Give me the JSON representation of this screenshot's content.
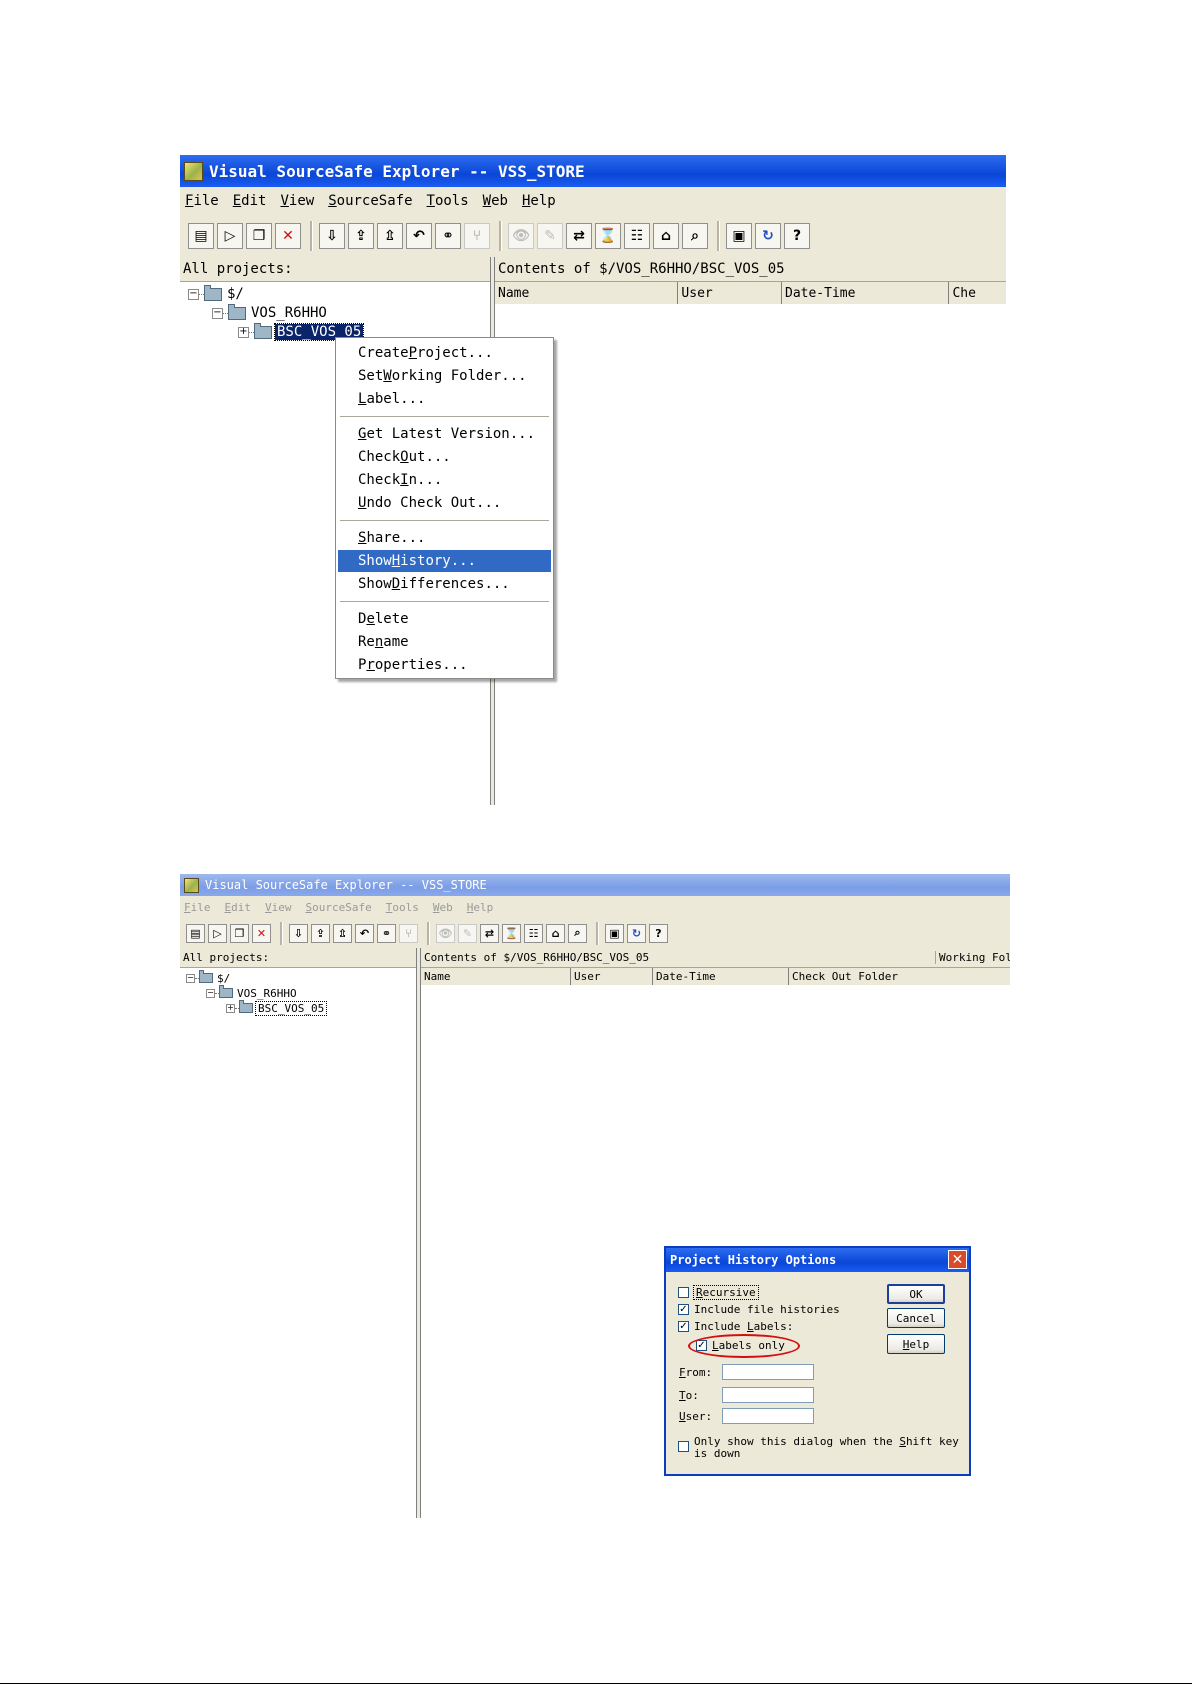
{
  "window_top": {
    "title": "Visual SourceSafe Explorer -- VSS_STORE",
    "menu": [
      {
        "pre": "",
        "u": "F",
        "post": "ile"
      },
      {
        "pre": "",
        "u": "E",
        "post": "dit"
      },
      {
        "pre": "",
        "u": "V",
        "post": "iew"
      },
      {
        "pre": "",
        "u": "S",
        "post": "ourceSafe"
      },
      {
        "pre": "",
        "u": "T",
        "post": "ools"
      },
      {
        "pre": "",
        "u": "W",
        "post": "eb"
      },
      {
        "pre": "",
        "u": "H",
        "post": "elp"
      }
    ],
    "all_projects_label": "All projects:",
    "contents_label": "Contents of $/VOS_R6HHO/BSC_VOS_05",
    "columns": [
      "Name",
      "User",
      "Date-Time",
      "Che"
    ],
    "tree": [
      "$/",
      "VOS_R6HHO",
      "BSC_VOS_05"
    ],
    "context_menu": [
      {
        "pre": "Create ",
        "u": "P",
        "post": "roject..."
      },
      {
        "pre": "Set ",
        "u": "W",
        "post": "orking Folder..."
      },
      {
        "pre": "",
        "u": "L",
        "post": "abel..."
      },
      {
        "pre": "",
        "u": "G",
        "post": "et Latest Version..."
      },
      {
        "pre": "Check ",
        "u": "O",
        "post": "ut..."
      },
      {
        "pre": "Check ",
        "u": "I",
        "post": "n..."
      },
      {
        "pre": "",
        "u": "U",
        "post": "ndo Check Out..."
      },
      {
        "pre": "",
        "u": "S",
        "post": "hare..."
      },
      {
        "pre": "Show ",
        "u": "H",
        "post": "istory..."
      },
      {
        "pre": "Show ",
        "u": "D",
        "post": "ifferences..."
      },
      {
        "pre": "D",
        "u": "e",
        "post": "lete"
      },
      {
        "pre": "Re",
        "u": "n",
        "post": "ame"
      },
      {
        "pre": "P",
        "u": "r",
        "post": "operties..."
      }
    ],
    "highlighted_item": "Show History..."
  },
  "window_bottom": {
    "title": "Visual SourceSafe Explorer -- VSS_STORE",
    "menu": [
      {
        "pre": "",
        "u": "F",
        "post": "ile"
      },
      {
        "pre": "",
        "u": "E",
        "post": "dit"
      },
      {
        "pre": "",
        "u": "V",
        "post": "iew"
      },
      {
        "pre": "",
        "u": "S",
        "post": "ourceSafe"
      },
      {
        "pre": "",
        "u": "T",
        "post": "ools"
      },
      {
        "pre": "",
        "u": "W",
        "post": "eb"
      },
      {
        "pre": "",
        "u": "H",
        "post": "elp"
      }
    ],
    "all_projects_label": "All projects:",
    "contents_label": "Contents of $/VOS_R6HHO/BSC_VOS_05",
    "working_folder_label": "Working Folder",
    "columns": [
      "Name",
      "User",
      "Date-Time",
      "Check Out Folder"
    ],
    "tree": [
      "$/",
      "VOS_R6HHO",
      "BSC_VOS_05"
    ]
  },
  "dialog": {
    "title": "Project History Options",
    "checkboxes": [
      {
        "pre": "",
        "u": "R",
        "post": "ecursive",
        "checked": false
      },
      {
        "pre": "Include file histories",
        "u": "",
        "post": "",
        "checked": true
      },
      {
        "pre": "Include ",
        "u": "L",
        "post": "abels:",
        "checked": true
      },
      {
        "pre": "",
        "u": "L",
        "post": "abels only",
        "checked": true
      }
    ],
    "buttons": [
      {
        "pre": "OK",
        "u": "",
        "post": ""
      },
      {
        "pre": "Cancel",
        "u": "",
        "post": ""
      },
      {
        "pre": "",
        "u": "H",
        "post": "elp"
      }
    ],
    "fields": [
      {
        "pre": "",
        "u": "F",
        "post": "rom:",
        "value": ""
      },
      {
        "pre": "",
        "u": "T",
        "post": "o:",
        "value": ""
      },
      {
        "pre": "",
        "u": "U",
        "post": "ser:",
        "value": ""
      }
    ],
    "shift_checkbox": {
      "line1_pre": "Only show this dialog when the ",
      "line1_u": "S",
      "line1_post": "hift key",
      "line2": "is down",
      "checked": false
    }
  },
  "toolbar_icons": [
    "add-files-icon",
    "create-project-icon",
    "copy-icon",
    "delete-icon",
    "get-latest-icon",
    "check-out-icon",
    "check-in-icon",
    "undo-check-out-icon",
    "share-icon",
    "branch-icon",
    "view-file-icon",
    "edit-file-icon",
    "show-differences-icon",
    "show-history-icon",
    "properties-icon",
    "label-icon",
    "find-icon",
    "working-folder-icon",
    "refresh-icon",
    "help-icon"
  ]
}
